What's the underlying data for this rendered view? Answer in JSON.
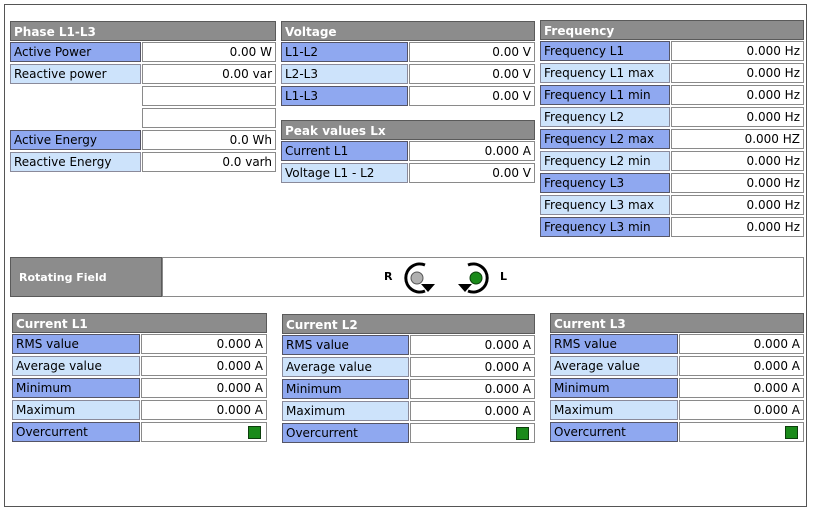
{
  "phase": {
    "title": "Phase L1-L3",
    "rows": [
      {
        "label": "Active Power",
        "value": "0.00 W"
      },
      {
        "label": "Reactive power",
        "value": "0.00 var"
      },
      {
        "label": "",
        "value": ""
      },
      {
        "label": "",
        "value": ""
      },
      {
        "label": "Active Energy",
        "value": "0.0 Wh"
      },
      {
        "label": "Reactive Energy",
        "value": "0.0 varh"
      }
    ]
  },
  "voltage": {
    "title": "Voltage",
    "rows": [
      {
        "label": "L1-L2",
        "value": "0.00 V"
      },
      {
        "label": "L2-L3",
        "value": "0.00 V"
      },
      {
        "label": "L1-L3",
        "value": "0.00 V"
      }
    ]
  },
  "peak": {
    "title": "Peak values Lx",
    "rows": [
      {
        "label": "Current L1",
        "value": "0.000 A"
      },
      {
        "label": "Voltage L1 - L2",
        "value": "0.00 V"
      }
    ]
  },
  "frequency": {
    "title": "Frequency",
    "rows": [
      {
        "label": "Frequency L1",
        "value": "0.000 Hz"
      },
      {
        "label": "Frequency L1 max",
        "value": "0.000 Hz"
      },
      {
        "label": "Frequency L1 min",
        "value": "0.000 Hz"
      },
      {
        "label": "Frequency L2",
        "value": "0.000 Hz"
      },
      {
        "label": "Frequency L2 max",
        "value": "0.000 HZ"
      },
      {
        "label": "Frequency L2 min",
        "value": "0.000 Hz"
      },
      {
        "label": "Frequency L3",
        "value": "0.000 Hz"
      },
      {
        "label": "Frequency L3 max",
        "value": "0.000 Hz"
      },
      {
        "label": "Frequency L3 min",
        "value": "0.000 Hz"
      }
    ]
  },
  "rotating": {
    "title": "Rotating Field",
    "left_label": "R",
    "right_label": "L",
    "left_indicator_color": "#b0b0b0",
    "right_indicator_color": "#1a8a1a"
  },
  "currents": [
    {
      "title": "Current L1",
      "rows": [
        {
          "label": "RMS value",
          "value": "0.000 A"
        },
        {
          "label": "Average value",
          "value": "0.000 A"
        },
        {
          "label": "Minimum",
          "value": "0.000 A"
        },
        {
          "label": "Maximum",
          "value": "0.000 A"
        },
        {
          "label": "Overcurrent",
          "indicator": "green-square-icon"
        }
      ]
    },
    {
      "title": "Current L2",
      "rows": [
        {
          "label": "RMS value",
          "value": "0.000 A"
        },
        {
          "label": "Average value",
          "value": "0.000 A"
        },
        {
          "label": "Minimum",
          "value": "0.000 A"
        },
        {
          "label": "Maximum",
          "value": "0.000 A"
        },
        {
          "label": "Overcurrent",
          "indicator": "green-square-icon"
        }
      ]
    },
    {
      "title": "Current L3",
      "rows": [
        {
          "label": "RMS value",
          "value": "0.000 A"
        },
        {
          "label": "Average value",
          "value": "0.000 A"
        },
        {
          "label": "Minimum",
          "value": "0.000 A"
        },
        {
          "label": "Maximum",
          "value": "0.000 A"
        },
        {
          "label": "Overcurrent",
          "indicator": "green-square-icon"
        }
      ]
    }
  ],
  "colors": {
    "header_bg": "#8c8c8c",
    "label_dark": "#8fa8f0",
    "label_light": "#cde3fb",
    "indicator_green": "#1a8a1a"
  }
}
